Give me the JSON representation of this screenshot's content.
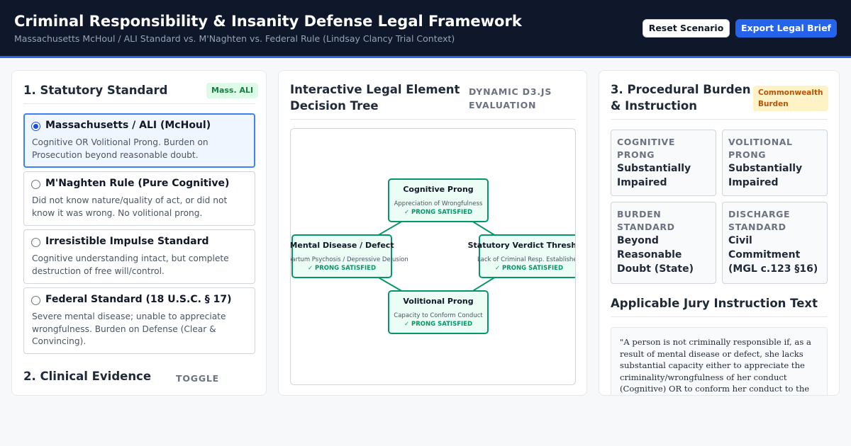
{
  "header": {
    "title": "Criminal Responsibility & Insanity Defense Legal Framework",
    "subtitle": "Massachusetts McHoul / ALI Standard vs. M'Naghten vs. Federal Rule (Lindsay Clancy Trial Context)",
    "reset_label": "Reset Scenario",
    "export_label": "Export Legal Brief"
  },
  "statutory": {
    "title": "1. Statutory Standard",
    "badge": "Mass. ALI",
    "selected_index": 0,
    "options": [
      {
        "label": "Massachusetts / ALI (McHoul)",
        "desc": "Cognitive OR Volitional Prong. Burden on Prosecution beyond reasonable doubt."
      },
      {
        "label": "M'Naghten Rule (Pure Cognitive)",
        "desc": "Did not know nature/quality of act, or did not know it was wrong. No volitional prong."
      },
      {
        "label": "Irresistible Impulse Standard",
        "desc": "Cognitive understanding intact, but complete destruction of free will/control."
      },
      {
        "label": "Federal Standard (18 U.S.C. § 17)",
        "desc": "Severe mental disease; unable to appreciate wrongfulness. Burden on Defense (Clear & Convincing)."
      }
    ]
  },
  "clinical": {
    "title": "2. Clinical Evidence",
    "toggle_label": "TOGGLE"
  },
  "tree": {
    "title": "Interactive Legal Element Decision Tree",
    "kicker": "DYNAMIC D3.JS EVALUATION",
    "colors": {
      "border": "#059669",
      "fill": "#ecfdf5",
      "edge": "#059669",
      "status": "#059669"
    },
    "nodes": [
      {
        "title": "Cognitive Prong",
        "subtitle": "Appreciation of Wrongfulness",
        "status": "✓ PRONG SATISFIED"
      },
      {
        "title": "Mental Disease / Defect",
        "subtitle": "Postpartum Psychosis / Depressive Delusion",
        "status": "✓ PRONG SATISFIED"
      },
      {
        "title": "Statutory Verdict Threshold",
        "subtitle": "Lack of Criminal Resp. Established",
        "status": "✓ PRONG SATISFIED"
      },
      {
        "title": "Volitional Prong",
        "subtitle": "Capacity to Conform Conduct",
        "status": "✓ PRONG SATISFIED"
      }
    ]
  },
  "procedural": {
    "title": "3. Procedural Burden & Instruction",
    "badge": "Commonwealth Burden",
    "cards": [
      {
        "label": "COGNITIVE PRONG",
        "value": "Substantially Impaired"
      },
      {
        "label": "VOLITIONAL PRONG",
        "value": "Substantially Impaired"
      },
      {
        "label": "BURDEN STANDARD",
        "value": "Beyond Reasonable Doubt (State)"
      },
      {
        "label": "DISCHARGE STANDARD",
        "value": "Civil Commitment (MGL c.123 §16)"
      }
    ]
  },
  "jury": {
    "title": "Applicable Jury Instruction Text",
    "text": "\"A person is not criminally responsible if, as a result of mental disease or defect, she lacks substantial capacity either to appreciate the criminality/wrongfulness of her conduct (Cognitive) OR to conform her conduct to the requirements of law (Volitional).\""
  }
}
